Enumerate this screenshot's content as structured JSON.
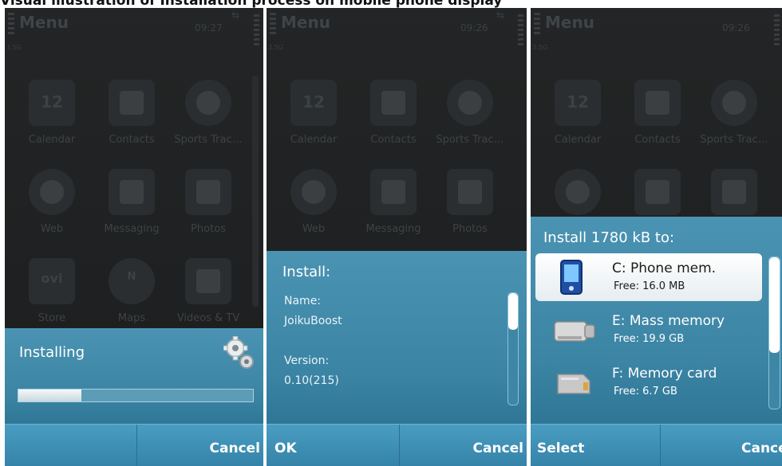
{
  "caption": "Visual illustration of Installation process on mobile phone display",
  "menu": {
    "title": "Menu",
    "signal_label": "3.5G",
    "apps": [
      {
        "label": "Calendar",
        "icon": "calendar-icon",
        "day": "12"
      },
      {
        "label": "Contacts",
        "icon": "contacts-icon"
      },
      {
        "label": "Sports Trac…",
        "icon": "sports-tracker-icon"
      },
      {
        "label": "Web",
        "icon": "globe-icon"
      },
      {
        "label": "Messaging",
        "icon": "envelope-icon"
      },
      {
        "label": "Photos",
        "icon": "photos-icon"
      },
      {
        "label": "Store",
        "icon": "ovi-store-icon",
        "icon_text": "ovi"
      },
      {
        "label": "Maps",
        "icon": "compass-icon",
        "icon_text": "N"
      },
      {
        "label": "Videos & TV",
        "icon": "film-icon"
      }
    ]
  },
  "screens": [
    {
      "clock": "09:27",
      "dialog": {
        "title": "Installing",
        "icon": "gears-icon",
        "progress": 0.27
      },
      "softkeys": {
        "left": "",
        "right": "Cancel"
      }
    },
    {
      "clock": "09:26",
      "dialog": {
        "title": "Install:",
        "name_label": "Name:",
        "name_value": "JoikuBoost",
        "version_label": "Version:",
        "version_value": "0.10(215)"
      },
      "softkeys": {
        "left": "OK",
        "right": "Cancel"
      }
    },
    {
      "clock": "09:26",
      "dialog": {
        "title": "Install 1780 kB to:",
        "options": [
          {
            "name": "C: Phone mem.",
            "free": "Free: 16.0 MB",
            "icon": "phone-memory-icon",
            "selected": true
          },
          {
            "name": "E: Mass memory",
            "free": "Free: 19.9 GB",
            "icon": "mass-memory-icon",
            "selected": false
          },
          {
            "name": "F: Memory card",
            "free": "Free: 6.7 GB",
            "icon": "memory-card-icon",
            "selected": false
          }
        ]
      },
      "softkeys": {
        "left": "Select",
        "right": "Cancel"
      }
    }
  ],
  "colors": {
    "dialog_blue": "#3b84a4",
    "softbar_blue": "#3583a9",
    "background_dim": "#1e2021"
  }
}
